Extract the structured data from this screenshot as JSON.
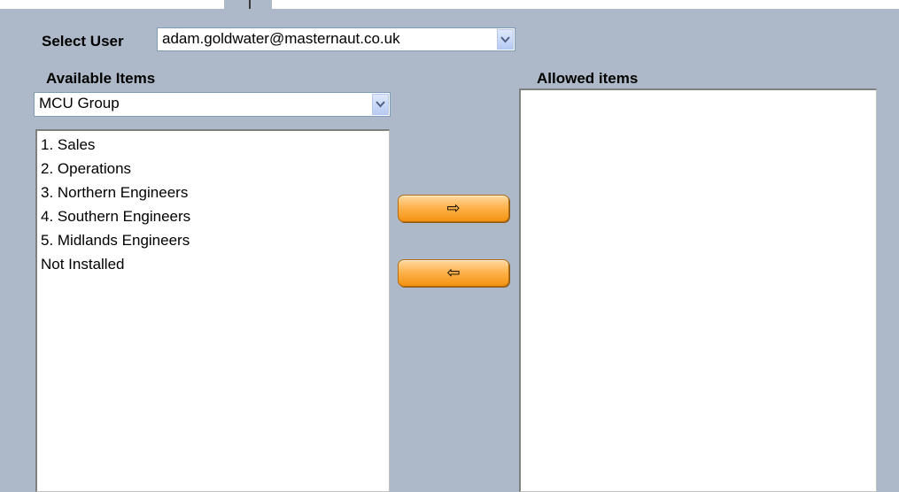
{
  "user_select": {
    "label": "Select User",
    "value": "adam.goldwater@masternaut.co.uk"
  },
  "available": {
    "label": "Available Items",
    "filter_value": "MCU Group",
    "items": [
      "1. Sales",
      "2. Operations",
      "3. Northern Engineers",
      "4. Southern Engineers",
      "5. Midlands Engineers",
      "Not Installed"
    ]
  },
  "allowed": {
    "label": "Allowed items",
    "items": []
  },
  "buttons": {
    "add_glyph": "⇨",
    "remove_glyph": "⇦"
  }
}
